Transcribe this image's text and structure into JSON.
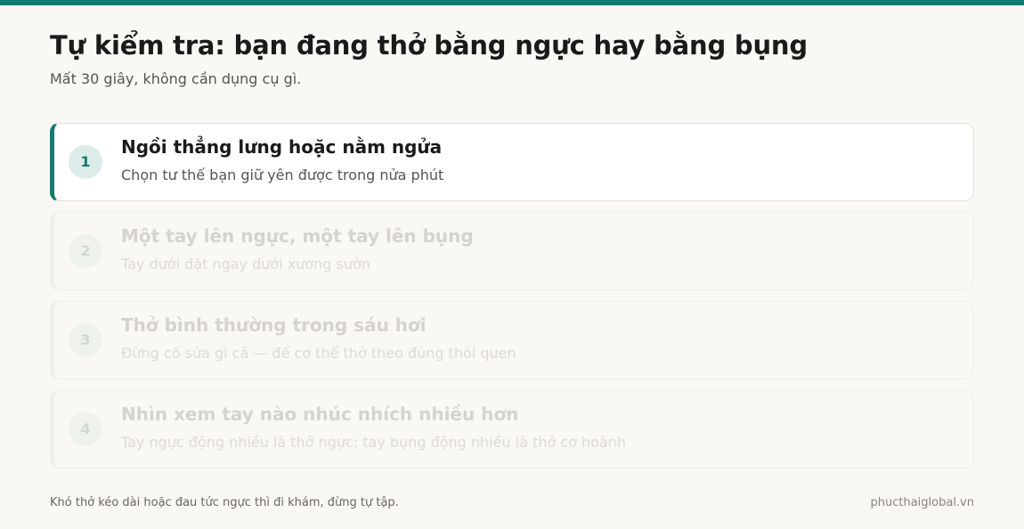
{
  "header": {
    "title": "Tự kiểm tra: bạn đang thở bằng ngực hay bằng bụng",
    "subtitle": "Mất 30 giây, không cần dụng cụ gì."
  },
  "steps": [
    {
      "number": "1",
      "title": "Ngồi thẳng lưng hoặc nằm ngửa",
      "description": "Chọn tư thế bạn giữ yên được trong nửa phút",
      "state": "active"
    },
    {
      "number": "2",
      "title": "Một tay lên ngực, một tay lên bụng",
      "description": "Tay dưới đặt ngay dưới xương sườn",
      "state": "inactive"
    },
    {
      "number": "3",
      "title": "Thở bình thường trong sáu hơi",
      "description": "Đừng cố sửa gì cả — để cơ thể thở theo đúng thói quen",
      "state": "inactive"
    },
    {
      "number": "4",
      "title": "Nhìn xem tay nào nhúc nhích nhiều hơn",
      "description": "Tay ngực động nhiều là thở ngực; tay bụng động nhiều là thở cơ hoành",
      "state": "inactive"
    }
  ],
  "footer": {
    "note": "Khó thở kéo dài hoặc đau tức ngực thì đi khám, đừng tự tập.",
    "site": "phucthaiglobal.vn"
  },
  "colors": {
    "accent": "#157a70",
    "background": "#faf8f4"
  }
}
